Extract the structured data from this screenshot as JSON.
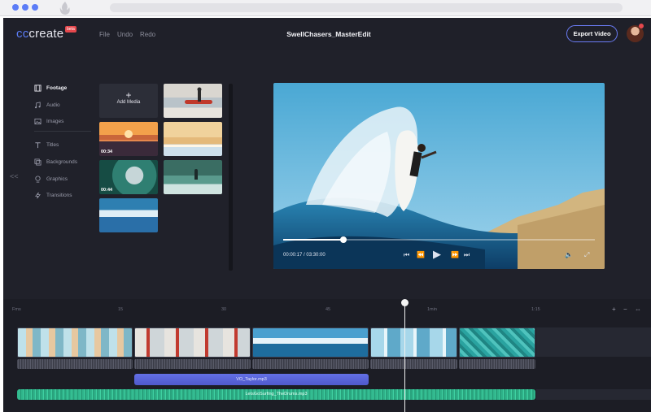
{
  "app": {
    "logo_text_prefix": "cc",
    "logo_text_suffix": "create",
    "logo_badge": "beta",
    "menu": [
      "File",
      "Undo",
      "Redo"
    ],
    "project_title": "SwellChasers_MasterEdit",
    "export_label": "Export Video"
  },
  "sidebar": {
    "items": [
      {
        "label": "Footage",
        "icon": "film-icon",
        "active": true
      },
      {
        "label": "Audio",
        "icon": "music-note-icon",
        "active": false
      },
      {
        "label": "Images",
        "icon": "image-icon",
        "active": false
      },
      {
        "label": "Titles",
        "icon": "text-icon",
        "active": false
      },
      {
        "label": "Backgrounds",
        "icon": "layers-icon",
        "active": false
      },
      {
        "label": "Graphics",
        "icon": "shapes-icon",
        "active": false
      },
      {
        "label": "Transitions",
        "icon": "lightning-icon",
        "active": false
      }
    ],
    "collapse_glyph": "<<"
  },
  "media": {
    "add_label": "Add Media",
    "durations": [
      "00:34",
      "00:44"
    ]
  },
  "player": {
    "timecode": "00:00:17 / 03:30:00"
  },
  "timeline": {
    "ruler": [
      "Fms",
      "15",
      "30",
      "45",
      "1min",
      "1:15"
    ],
    "zoom_controls": [
      "+",
      "−",
      "⇔"
    ],
    "audio_tracks": [
      {
        "name": "VO_Taylor.mp3"
      },
      {
        "name": "LetsGoSurfing_TheDrums.mp3"
      }
    ]
  },
  "colors": {
    "accent": "#5b7cf7",
    "vo_track": "#5b65db",
    "music_track": "#34c394",
    "background": "#20212a"
  }
}
